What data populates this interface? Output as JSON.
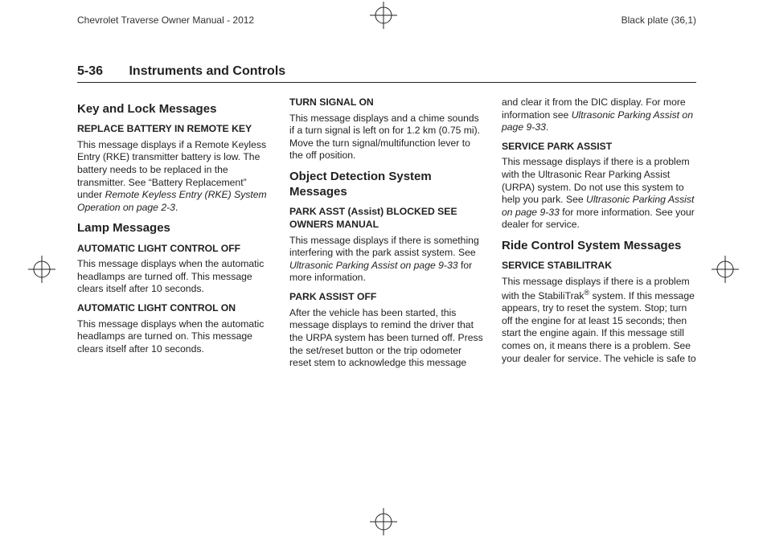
{
  "header": {
    "manualTitle": "Chevrolet Traverse Owner Manual - 2012",
    "plateInfo": "Black plate (36,1)",
    "pageNumber": "5-36",
    "chapterTitle": "Instruments and Controls"
  },
  "col1": {
    "h_key": "Key and Lock Messages",
    "h_replace": "REPLACE BATTERY IN REMOTE KEY",
    "p_replace_a": "This message displays if a Remote Keyless Entry (RKE) transmitter battery is low. The battery needs to be replaced in the transmitter. See “Battery Replacement” under ",
    "p_replace_i": "Remote Keyless Entry (RKE) System Operation on page 2-3",
    "p_replace_b": ".",
    "h_lamp": "Lamp Messages",
    "h_auto_off": "AUTOMATIC LIGHT CONTROL OFF",
    "p_auto_off": "This message displays when the automatic headlamps are turned off. This message clears itself after 10 seconds.",
    "h_auto_on": "AUTOMATIC LIGHT CONTROL ON",
    "p_auto_on": "This message displays when the automatic headlamps are turned on. This message clears itself after 10 seconds."
  },
  "col2": {
    "h_turn": "TURN SIGNAL ON",
    "p_turn": "This message displays and a chime sounds if a turn signal is left on for 1.2 km (0.75 mi). Move the turn signal/multifunction lever to the off position.",
    "h_obj": "Object Detection System Messages",
    "h_parkasst": "PARK ASST (Assist) BLOCKED SEE OWNERS MANUAL",
    "p_parkasst_a": "This message displays if there is something interfering with the park assist system. See ",
    "p_parkasst_i": "Ultrasonic Parking Assist on page 9-33",
    "p_parkasst_b": " for more information.",
    "h_parkoff": "PARK ASSIST OFF",
    "p_parkoff": "After the vehicle has been started, this message displays to remind the driver that the URPA system has been turned off. Press the set/reset button or the trip odometer reset stem to acknowledge this message"
  },
  "col3": {
    "p_cont_a": "and clear it from the DIC display. For more information see ",
    "p_cont_i": "Ultrasonic Parking Assist on page 9-33",
    "p_cont_b": ".",
    "h_spa": "SERVICE PARK ASSIST",
    "p_spa_a": "This message displays if there is a problem with the Ultrasonic Rear Parking Assist (URPA) system. Do not use this system to help you park. See ",
    "p_spa_i": "Ultrasonic Parking Assist on page 9-33",
    "p_spa_b": " for more information. See your dealer for service.",
    "h_ride": "Ride Control System Messages",
    "h_stab": "SERVICE STABILITRAK",
    "p_stab_a": "This message displays if there is a problem with the StabiliTrak",
    "p_stab_sup": "®",
    "p_stab_b": " system. If this message appears, try to reset the system. Stop; turn off the engine for at least 15 seconds; then start the engine again. If this message still comes on, it means there is a problem. See your dealer for service. The vehicle is safe to"
  }
}
